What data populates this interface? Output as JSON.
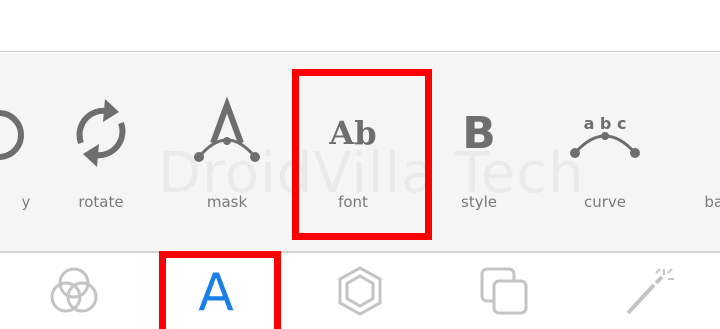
{
  "tools": [
    {
      "id": "y",
      "label": "y",
      "icon": "partial-circle-icon"
    },
    {
      "id": "rotate",
      "label": "rotate",
      "icon": "rotate-icon"
    },
    {
      "id": "mask",
      "label": "mask",
      "icon": "mask-icon"
    },
    {
      "id": "font",
      "label": "font",
      "icon": "font-icon",
      "icon_text": "Ab"
    },
    {
      "id": "style",
      "label": "style",
      "icon": "style-icon",
      "icon_text": "B"
    },
    {
      "id": "curve",
      "label": "curve",
      "icon": "curve-icon",
      "icon_text": "a b c"
    },
    {
      "id": "back",
      "label": "bacl",
      "icon": "background-icon"
    }
  ],
  "tabs": [
    {
      "id": "filters",
      "icon": "overlapping-circles-icon",
      "active": false
    },
    {
      "id": "text",
      "icon": "letter-a-icon",
      "icon_text": "A",
      "active": true
    },
    {
      "id": "shapes",
      "icon": "hexagon-icon",
      "active": false
    },
    {
      "id": "layers",
      "icon": "overlapping-squares-icon",
      "active": false
    },
    {
      "id": "effects",
      "icon": "magic-wand-icon",
      "active": false
    }
  ],
  "watermark": "DroidVilla Tech",
  "colors": {
    "accent": "#1a7fe8",
    "highlight": "#ff0000",
    "icon_gray": "#6e6e6e",
    "label_gray": "#7a7a7a",
    "tab_icon_gray": "#c4c4c4",
    "strip_bg": "#f5f5f5"
  }
}
